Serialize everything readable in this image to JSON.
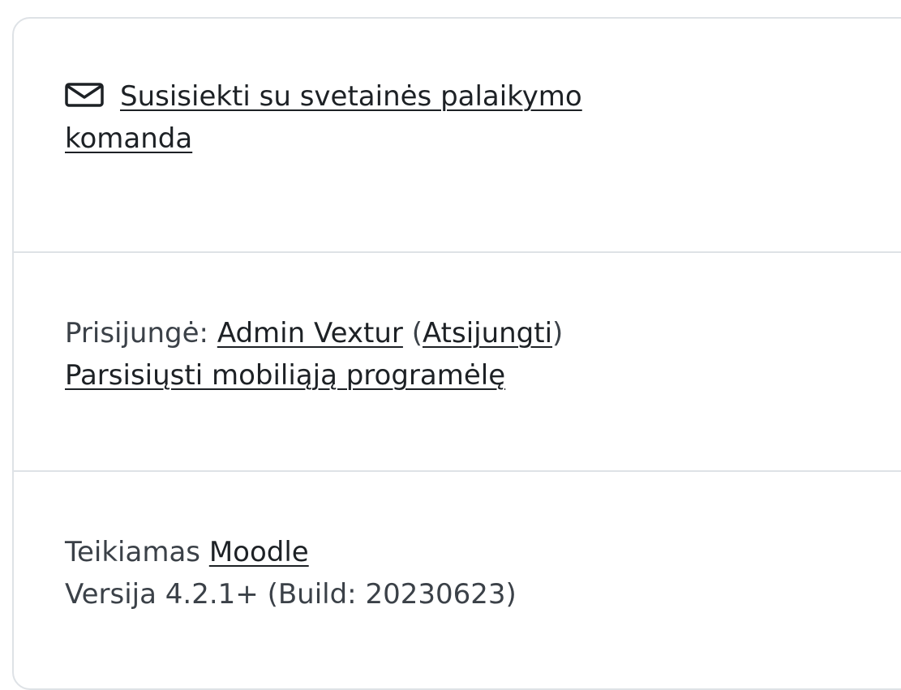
{
  "support": {
    "icon": "envelope-icon",
    "link_text": "Susisiekti su svetainės palaikymo",
    "link_text_cont": "komanda"
  },
  "login_info": {
    "prefix": "Prisijungė:",
    "user_name": "Admin Vextur",
    "logout_open": "(",
    "logout_label": "Atsijungti",
    "logout_close": ")",
    "mobile_app_link": "Parsisiųsti mobiliąją programėlę"
  },
  "footer": {
    "powered_by_prefix": "Teikiamas",
    "powered_by_link": "Moodle",
    "version_text": "Versija 4.2.1+ (Build: 20230623)"
  }
}
